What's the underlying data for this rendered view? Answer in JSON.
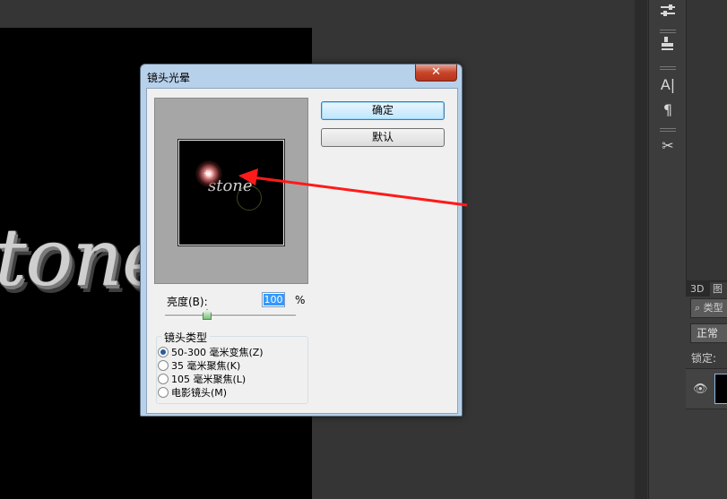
{
  "canvas": {
    "text": "tone"
  },
  "right_panel": {
    "tools": [
      "sliders-icon",
      "stamp-icon",
      "character-icon",
      "paragraph-icon",
      "tools-icon"
    ],
    "tool_glyphs": {
      "character": "A|",
      "paragraph": "¶",
      "tools": "✂"
    },
    "tabs": [
      "3D",
      "图"
    ],
    "search_text": "类型",
    "blend_mode": "正常",
    "lock_label": "锁定:"
  },
  "dialog": {
    "title": "镜头光晕",
    "close_glyph": "✕",
    "preview_text": "stone",
    "ok_label": "确定",
    "reset_label": "默认",
    "brightness_label": "亮度(B):",
    "brightness_value": "100",
    "percent": "%",
    "brightness_level": 1.0,
    "lens_group_title": "镜头类型",
    "lens_options": [
      {
        "label": "50-300 毫米变焦(Z)",
        "selected": true
      },
      {
        "label": "35 毫米聚焦(K)",
        "selected": false
      },
      {
        "label": "105 毫米聚焦(L)",
        "selected": false
      },
      {
        "label": "电影镜头(M)",
        "selected": false
      }
    ]
  },
  "annotation": {
    "arrow_color": "#ff1a1a"
  }
}
